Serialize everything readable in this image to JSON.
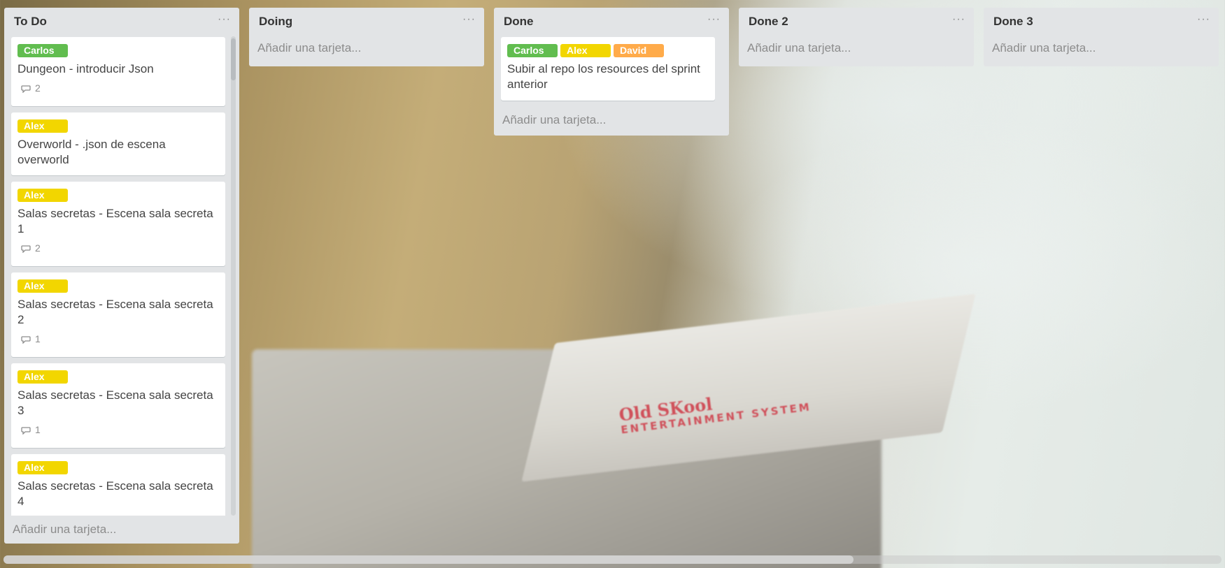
{
  "lists": [
    {
      "title": "To Do",
      "menu": "···",
      "add_card": "Añadir una tarjeta...",
      "cards": [
        {
          "labels": [
            {
              "text": "Carlos",
              "color": "#61bd4f"
            }
          ],
          "title": "Dungeon - introducir Json",
          "comments": "2"
        },
        {
          "labels": [
            {
              "text": "Alex",
              "color": "#f2d600"
            }
          ],
          "title": "Overworld - .json de escena overworld",
          "comments": ""
        },
        {
          "labels": [
            {
              "text": "Alex",
              "color": "#f2d600"
            }
          ],
          "title": "Salas secretas - Escena sala secreta 1",
          "comments": "2"
        },
        {
          "labels": [
            {
              "text": "Alex",
              "color": "#f2d600"
            }
          ],
          "title": "Salas secretas - Escena sala secreta 2",
          "comments": "1"
        },
        {
          "labels": [
            {
              "text": "Alex",
              "color": "#f2d600"
            }
          ],
          "title": "Salas secretas - Escena sala secreta 3",
          "comments": "1"
        },
        {
          "labels": [
            {
              "text": "Alex",
              "color": "#f2d600"
            }
          ],
          "title": "Salas secretas - Escena sala secreta 4",
          "comments": ""
        }
      ]
    },
    {
      "title": "Doing",
      "menu": "···",
      "add_card": "Añadir una tarjeta...",
      "cards": []
    },
    {
      "title": "Done",
      "menu": "···",
      "add_card": "Añadir una tarjeta...",
      "cards": [
        {
          "labels": [
            {
              "text": "Carlos",
              "color": "#61bd4f"
            },
            {
              "text": "Alex",
              "color": "#f2d600"
            },
            {
              "text": "David",
              "color": "#ffab4a"
            }
          ],
          "title": "Subir al repo los resources del sprint anterior",
          "comments": ""
        }
      ]
    },
    {
      "title": "Done 2",
      "menu": "···",
      "add_card": "Añadir una tarjeta...",
      "cards": []
    },
    {
      "title": "Done 3",
      "menu": "···",
      "add_card": "Añadir una tarjeta...",
      "cards": []
    }
  ],
  "background": {
    "brand_line1": "Old SKool",
    "brand_line2": "ENTERTAINMENT SYSTEM"
  },
  "icons": {
    "comment": "comment-icon",
    "menu": "ellipsis-icon"
  }
}
